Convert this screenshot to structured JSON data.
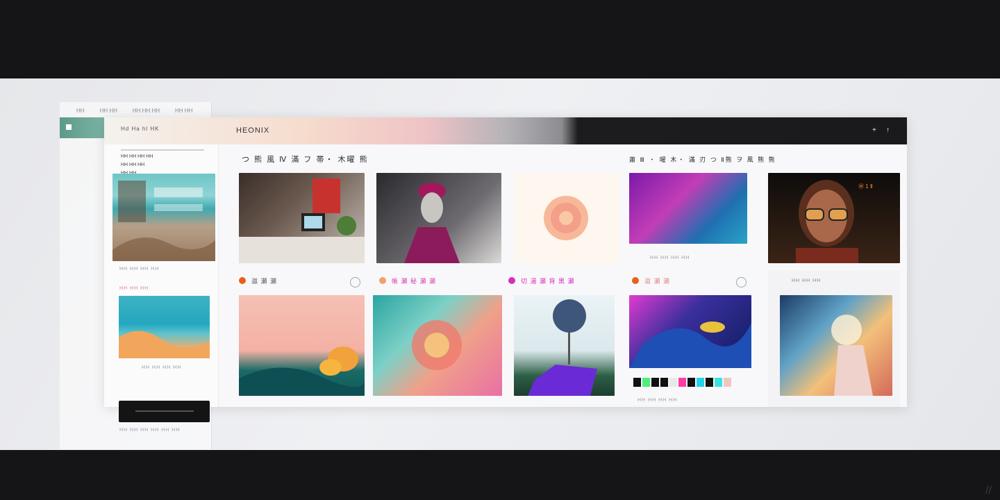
{
  "window": {
    "title": "HEONIX",
    "nav_text": "Hd Ha hl HK",
    "controls": [
      "+",
      "↑"
    ]
  },
  "ghost_tabs": [
    "HH",
    "HH HH",
    "HH HH HH",
    "HH HH"
  ],
  "sidebar": {
    "lines": [
      "HH HH HH HH",
      "HH HH HH",
      "HH HH"
    ],
    "caption_1": "HH HH HH HH",
    "caption_2": "HH HH HH",
    "footer_text": "HH HH HH HH HH HH"
  },
  "headings": {
    "left": "つ 熊 風 Ⅳ 滿 フ 帯・ 木曜  熊",
    "right": "蕭 Ⅲ ・ 曜 木・ 滿  刃 つ Ⅱ熊  ヲ 風 熊 熊"
  },
  "cards": [
    {
      "title": "滋 瀬 瀬",
      "color": "#e8611c"
    },
    {
      "title": "帳 瀬   秘 瀬 瀬",
      "color": "#e33aa3"
    },
    {
      "title": "切 湯 瀬 背 黒 瀬",
      "color": "#d62fbd"
    },
    {
      "title": "滋 瀬 瀬",
      "color": "#e8611c"
    },
    {
      "title": "HH HH HH",
      "color": "#777"
    }
  ],
  "portrait_badge": "Ⓜ 1 Ⅱ",
  "accent_colors": {
    "orange": "#e8611c",
    "magenta": "#e33aa3",
    "teal": "#5d9a8a"
  },
  "swatches": [
    "#111111",
    "#4ef07a",
    "#111111",
    "#111111",
    "#e8e8e8",
    "#ff3ca6",
    "#111111",
    "#22d3ea",
    "#111111",
    "#38e3e6",
    "#f0c7c0"
  ]
}
